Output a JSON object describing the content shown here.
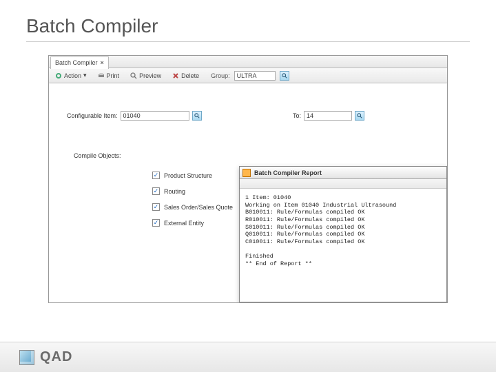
{
  "page": {
    "title": "Batch Compiler"
  },
  "window": {
    "tab": {
      "label": "Batch Compiler"
    },
    "toolbar": {
      "action": "Action",
      "print": "Print",
      "preview": "Preview",
      "delete": "Delete",
      "group_label": "Group:",
      "group_value": "ULTRA"
    }
  },
  "form": {
    "config_item_label": "Configurable Item:",
    "config_item_value": "01040",
    "to_label": "To:",
    "to_value": "14",
    "compile_objects_label": "Compile Objects:",
    "checks": [
      {
        "label": "Product Structure",
        "checked": true
      },
      {
        "label": "Routing",
        "checked": true
      },
      {
        "label": "Sales Order/Sales Quote",
        "checked": true
      },
      {
        "label": "External Entity",
        "checked": true
      }
    ]
  },
  "report": {
    "title": "Batch Compiler Report",
    "lines": [
      "1 Item: 01040",
      "Working on Item 01040 Industrial Ultrasound",
      "B010011: Rule/Formulas compiled OK",
      "R010011: Rule/Formulas compiled OK",
      "S010011: Rule/Formulas compiled OK",
      "Q010011: Rule/Formulas compiled OK",
      "C010011: Rule/Formulas compiled OK",
      "",
      "Finished",
      "** End of Report **"
    ]
  },
  "footer": {
    "brand": "QAD"
  }
}
